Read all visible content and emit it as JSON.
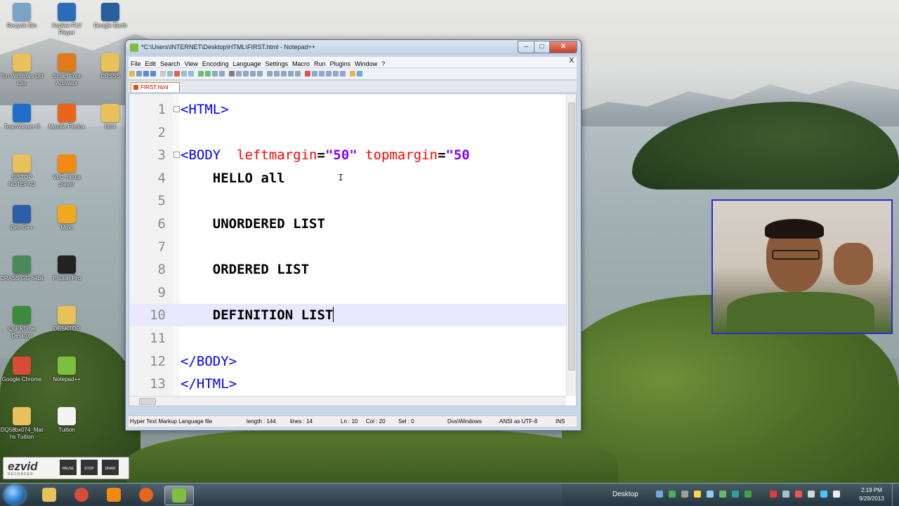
{
  "desktop": {
    "icons": [
      {
        "label": "Recycle Bin",
        "icon": "recycle-bin-icon",
        "color": "#7aa3c8"
      },
      {
        "label": "Xoplaw FLV Player",
        "icon": "flv-player-icon",
        "color": "#2b6cb8"
      },
      {
        "label": "Google Earth",
        "icon": "google-earth-icon",
        "color": "#2a5f9e"
      },
      {
        "label": "Ton Windows Util Lite",
        "icon": "folder-icon",
        "color": "#e8c15a"
      },
      {
        "label": "Smart Font Activator",
        "icon": "font-activator-icon",
        "color": "#e07a1f"
      },
      {
        "label": "CUSSS",
        "icon": "folder-icon",
        "color": "#e8c15a"
      },
      {
        "label": "TeamViewer 8",
        "icon": "teamviewer-icon",
        "color": "#1e6fc8"
      },
      {
        "label": "Mozilla Firefox",
        "icon": "firefox-icon",
        "color": "#e8661c"
      },
      {
        "label": "html",
        "icon": "folder-icon",
        "color": "#e8c15a"
      },
      {
        "label": "SISTOP NOTEPAD",
        "icon": "folder-icon",
        "color": "#e8c15a"
      },
      {
        "label": "VLC media player",
        "icon": "vlc-icon",
        "color": "#f08a12"
      },
      {
        "label": "Dev-C++",
        "icon": "devcpp-icon",
        "color": "#2b5fa8"
      },
      {
        "label": "Moio",
        "icon": "player-icon",
        "color": "#f2a81c"
      },
      {
        "label": "CRASS GG 64bit",
        "icon": "app-icon",
        "color": "#4a8a5a"
      },
      {
        "label": "Photon Pro",
        "icon": "photon-icon",
        "color": "#222222"
      },
      {
        "label": "QuickTime Desktop",
        "icon": "app-icon",
        "color": "#3c8a3c"
      },
      {
        "label": "DESKTOP",
        "icon": "folder-icon",
        "color": "#e8c15a"
      },
      {
        "label": "Google Chrome",
        "icon": "chrome-icon",
        "color": "#d94a38"
      },
      {
        "label": "Notepad++",
        "icon": "notepadpp-icon",
        "color": "#7fbf3f"
      },
      {
        "label": "DQ58bx074_Maths Tuition",
        "icon": "folder-icon",
        "color": "#e8c15a"
      },
      {
        "label": "Tuition",
        "icon": "document-icon",
        "color": "#f4f4f4"
      }
    ]
  },
  "window": {
    "title": "*C:\\Users\\INTERNET\\Desktop\\HTML\\FIRST.html - Notepad++",
    "min_label": "–",
    "max_label": "□",
    "close_label": "✕",
    "menu": [
      "File",
      "Edit",
      "Search",
      "View",
      "Encoding",
      "Language",
      "Settings",
      "Macro",
      "Run",
      "Plugins",
      "Window",
      "?"
    ],
    "menu_close": "X",
    "tab": {
      "label": "FIRST.html"
    },
    "lines": [
      {
        "num": "1",
        "segments": [
          {
            "t": "<HTML>",
            "c": "tag"
          }
        ]
      },
      {
        "num": "2",
        "segments": []
      },
      {
        "num": "3",
        "segments": [
          {
            "t": "<BODY",
            "c": "tag"
          },
          {
            "t": "  leftmargin",
            "c": "attr"
          },
          {
            "t": "=",
            "c": "txt"
          },
          {
            "t": "\"50\"",
            "c": "val"
          },
          {
            "t": " topmargin",
            "c": "attr"
          },
          {
            "t": "=",
            "c": "txt"
          },
          {
            "t": "\"50",
            "c": "val"
          }
        ]
      },
      {
        "num": "4",
        "segments": [
          {
            "t": "    HELLO all",
            "c": "txt"
          }
        ]
      },
      {
        "num": "5",
        "segments": []
      },
      {
        "num": "6",
        "segments": [
          {
            "t": "    UNORDERED LIST",
            "c": "txt"
          }
        ]
      },
      {
        "num": "7",
        "segments": []
      },
      {
        "num": "8",
        "segments": [
          {
            "t": "    ORDERED LIST",
            "c": "txt"
          }
        ]
      },
      {
        "num": "9",
        "segments": []
      },
      {
        "num": "10",
        "segments": [
          {
            "t": "    DEFINITION LIST",
            "c": "txt"
          }
        ],
        "current": true
      },
      {
        "num": "11",
        "segments": []
      },
      {
        "num": "12",
        "segments": [
          {
            "t": "</BODY>",
            "c": "tag"
          }
        ]
      },
      {
        "num": "13",
        "segments": [
          {
            "t": "</HTML>",
            "c": "tag"
          }
        ]
      }
    ],
    "status": {
      "file_type": "Hyper Text Markup Language file",
      "length": "length : 144",
      "lines": "lines : 14",
      "ln": "Ln : 10",
      "col": "Col : 20",
      "sel": "Sel : 0",
      "eol": "Dos\\Windows",
      "encoding": "ANSI as UTF-8",
      "mode": "INS"
    }
  },
  "ezvid": {
    "logo": "ezvid",
    "sub": "RECORDER",
    "controls": [
      "PAUSE",
      "STOP",
      "DRAW"
    ]
  },
  "taskbar": {
    "desktop_label": "Desktop",
    "time": "2:19 PM",
    "date": "9/29/2013"
  }
}
